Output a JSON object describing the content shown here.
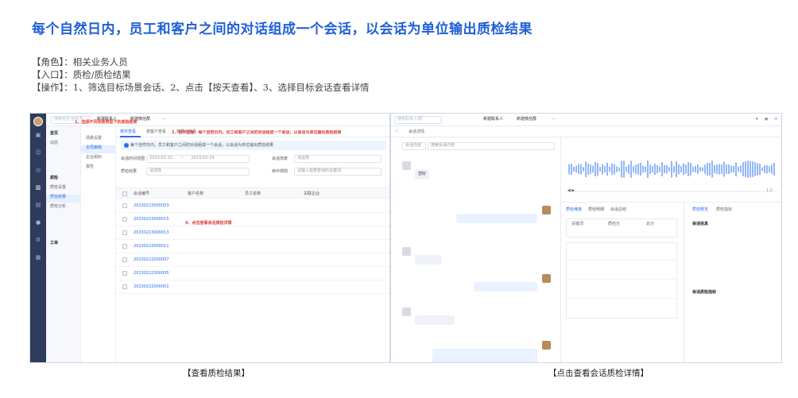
{
  "page": {
    "title": "每个自然日内，员工和客户之间的对话组成一个会话，以会话为单位输出质检结果",
    "role": "【角色】：相关业务人员",
    "entry": "【入口】：质检/质检结果",
    "steps": "【操作】：1、筛选目标场景会话、2、点击【按天查看】、3、选择目标会话查看详情"
  },
  "captions": {
    "left": "【查看质检结果】",
    "right": "【点击查看会话质检详情】"
  },
  "left_app": {
    "search_placeholder": "搜索姓名/手机号",
    "top_actions": [
      "新建联系人",
      "新建微信群"
    ],
    "more": "···",
    "nav": [
      "工作台",
      "客户",
      "群聊",
      "质检",
      "消息",
      "会话",
      "工单"
    ],
    "menu1": {
      "items": [
        {
          "label": "首页"
        },
        {
          "label": "动态"
        },
        {
          "label": "质检",
          "group": true
        },
        {
          "label": "质检设置"
        },
        {
          "label": "质检结果",
          "active": true
        },
        {
          "label": "质检分析"
        },
        {
          "label": "工单",
          "group": true
        }
      ]
    },
    "menu2": {
      "items": [
        {
          "label": "场景设置"
        },
        {
          "label": "全局策略",
          "active": true
        },
        {
          "label": "企业组织"
        },
        {
          "label": "报告"
        }
      ]
    },
    "tabs": [
      {
        "label": "按天查看",
        "active": true
      },
      {
        "label": "按客户查看"
      },
      {
        "label": "按员工查看"
      }
    ],
    "notice": "每个自然日内，员工和客户之间的对话组成一个会话，以会话为单位输出质检结果",
    "filters": {
      "time_label": "会话时间范围",
      "time_start": "2023-02-22",
      "time_sep": "~",
      "time_end": "2023-02-24",
      "scene_label": "会话场景",
      "scene_placeholder": "请选择",
      "rule_label": "质检结果",
      "rule_placeholder": "请选择",
      "keyword_label": "命中规则",
      "keyword_placeholder": "请输入需要查询的关键词"
    },
    "table": {
      "headers": [
        "会话编号",
        "客户名称",
        "员工名称",
        "关联企业"
      ],
      "rows": [
        {
          "id": "20230223000003",
          "customer": "",
          "staff": "",
          "company": ""
        },
        {
          "id": "20230223000015",
          "customer": "",
          "staff": "",
          "company": ""
        },
        {
          "id": "20230223000013",
          "customer": "",
          "staff": "",
          "company": ""
        },
        {
          "id": "20230223000011",
          "customer": "",
          "staff": "",
          "company": ""
        },
        {
          "id": "20230222000007",
          "customer": "",
          "staff": "",
          "company": ""
        },
        {
          "id": "20230222000005",
          "customer": "",
          "staff": "",
          "company": ""
        },
        {
          "id": "20230222000001",
          "customer": "",
          "staff": "",
          "company": ""
        }
      ]
    },
    "annotations": {
      "a1": "1、选择不同场景类型下的质检结果",
      "a2": "2、按天查看：每个自然日内，员工和客户之间的对话组成一个会话，以会话为单位输出质检结果",
      "a4": "4、点击查看会话质检详情"
    }
  },
  "right_app": {
    "search_placeholder": "搜索联系人/群",
    "top_actions": [
      "新建联系人",
      "新建微信群"
    ],
    "more": "···",
    "title": "会话详情",
    "chat_filter": "会话内容",
    "chat_search": "搜索会话内容",
    "date_divider": "",
    "audio_time": "",
    "speed": "1.0",
    "panel_tabs": [
      "质检维度",
      "质检明细",
      "会话总结"
    ],
    "score_labels": [
      "关键词",
      "质检分",
      "总分"
    ],
    "score_values": [
      "",
      "",
      ""
    ],
    "side_tabs": [
      "质检概览",
      "质检指标"
    ],
    "side_section1": "会话信息",
    "side_section2": "会话质检指标",
    "messages": [
      {
        "text": "您好",
        "tag": ""
      },
      {
        "text": "",
        "tag": ""
      },
      {
        "text": "",
        "tag": ""
      },
      {
        "text": "",
        "tag": ""
      },
      {
        "text": "",
        "tag": ""
      }
    ],
    "dims": [
      {
        "label": "",
        "result": ""
      },
      {
        "label": "",
        "result": ""
      },
      {
        "label": "",
        "result": ""
      },
      {
        "label": "",
        "result": ""
      }
    ]
  },
  "colors": {
    "accent": "#2a6cf0",
    "annotation": "#e03a2f",
    "title": "#1f5fd6",
    "sidebar": "#2f3b5a"
  }
}
